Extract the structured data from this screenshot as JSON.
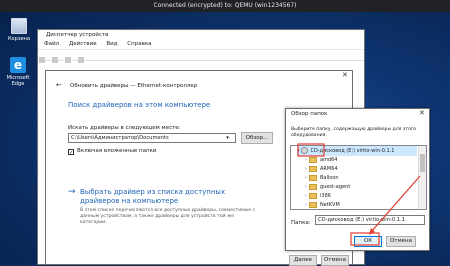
{
  "vnc": {
    "title": "Connected (encrypted) to: QEMU (win1234567)"
  },
  "desktop": {
    "icons": [
      {
        "label": "Корзина"
      },
      {
        "label": "Microsoft Edge"
      }
    ]
  },
  "device_manager": {
    "title": "Диспетчер устройств",
    "menu": [
      "Файл",
      "Действие",
      "Вид",
      "Справка"
    ]
  },
  "update_dialog": {
    "title": "Обновить драйверы — Ethernet-контроллер",
    "heading": "Поиск драйверов на этом компьютере",
    "search_label": "Искать драйверы в следующем месте:",
    "path_value": "C:\\Users\\Администратор\\Documents",
    "browse_label": "Обзор...",
    "include_subfolders_label": "Включая вложенные папки",
    "include_subfolders_checked": true,
    "pick_link": "Выбрать драйвер из списка доступных драйверов на компьютере",
    "pick_desc": "В этом списке перечисляются все доступные драйверы, совместимые с данным устройством, а также драйверы для устройств той же категории.",
    "next_label": "Далее",
    "cancel_label": "Отмена"
  },
  "folder_dialog": {
    "title": "Обзор папок",
    "instruction": "Выберите папку, содержащую драйверы для этого оборудования.",
    "tree": [
      {
        "label": "CD-дисковод (E:) virtio-win-0.1.1",
        "type": "cd",
        "expanded": true,
        "selected": true
      },
      {
        "label": "amd64",
        "type": "folder"
      },
      {
        "label": "ARM64",
        "type": "folder"
      },
      {
        "label": "Balloon",
        "type": "folder"
      },
      {
        "label": "guest-agent",
        "type": "folder"
      },
      {
        "label": "i386",
        "type": "folder"
      },
      {
        "label": "NetKVM",
        "type": "folder"
      }
    ],
    "folder_label": "Папка:",
    "folder_value": "CD-дисковод (E:) virtio-win-0.1.1",
    "ok_label": "ОК",
    "cancel_label": "Отмена"
  },
  "colors": {
    "annotation_arrow": "#e23a2e",
    "link_blue": "#1f63b8",
    "selection": "#cce8ff"
  },
  "icons": [
    "back-arrow-icon",
    "close-icon",
    "chevron-down-icon",
    "folder-icon",
    "cd-drive-icon",
    "link-arrow-icon",
    "recycle-bin-icon",
    "edge-icon"
  ]
}
